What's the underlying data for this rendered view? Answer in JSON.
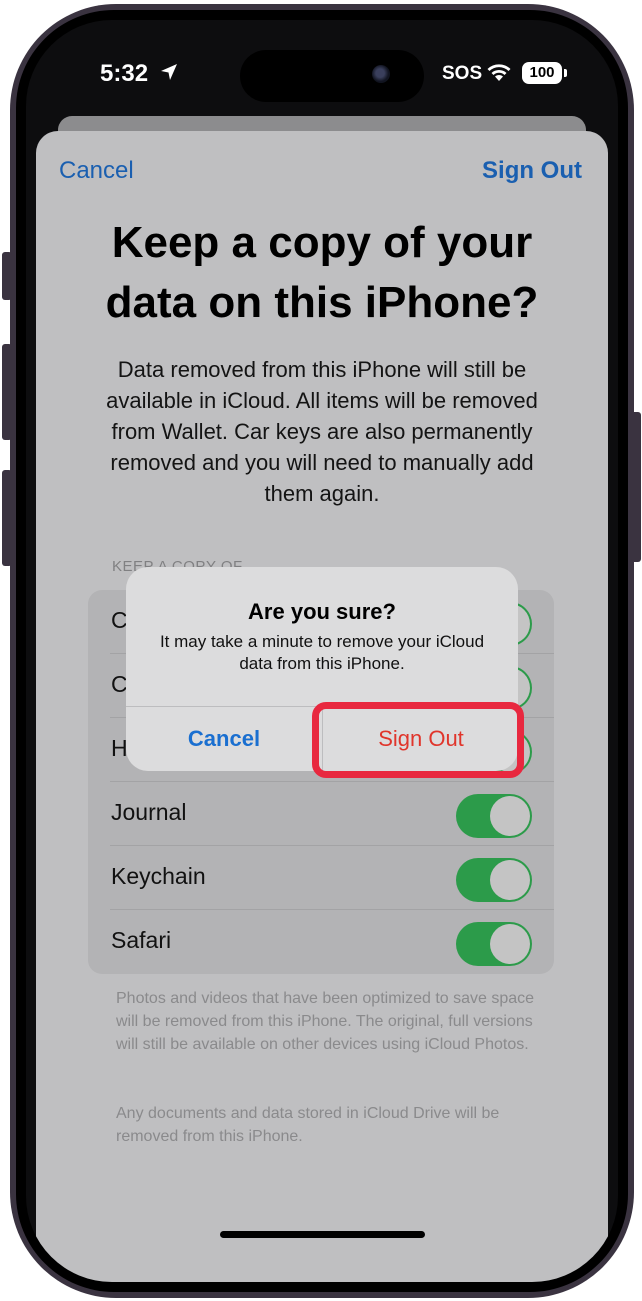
{
  "status_bar": {
    "time": "5:32",
    "sos": "SOS",
    "battery": "100"
  },
  "sheet": {
    "nav": {
      "cancel_label": "Cancel",
      "sign_out_label": "Sign Out"
    },
    "title": "Keep a copy of your data on this iPhone?",
    "description": "Data removed from this iPhone will still be available in iCloud. All items will be removed from Wallet. Car keys are also permanently removed and you will need to manually add them again.",
    "section_header": "KEEP A COPY OF",
    "items": [
      {
        "label": "C",
        "on": true
      },
      {
        "label": "C",
        "on": true
      },
      {
        "label": "H",
        "on": true
      },
      {
        "label": "Journal",
        "on": true
      },
      {
        "label": "Keychain",
        "on": true
      },
      {
        "label": "Safari",
        "on": true
      }
    ],
    "footer_photos": "Photos and videos that have been optimized to save space will be removed from this iPhone. The original, full versions will still be available on other devices using iCloud Photos.",
    "footer_drive": "Any documents and data stored in iCloud Drive will be removed from this iPhone."
  },
  "alert": {
    "title": "Are you sure?",
    "message": "It may take a minute to remove your iCloud data from this iPhone.",
    "cancel_label": "Cancel",
    "sign_out_label": "Sign Out"
  },
  "colors": {
    "accent_blue": "#1a5fb0",
    "destructive_red": "#e0352b",
    "highlight_red": "#e8283f",
    "toggle_green": "#2c9b4a"
  }
}
